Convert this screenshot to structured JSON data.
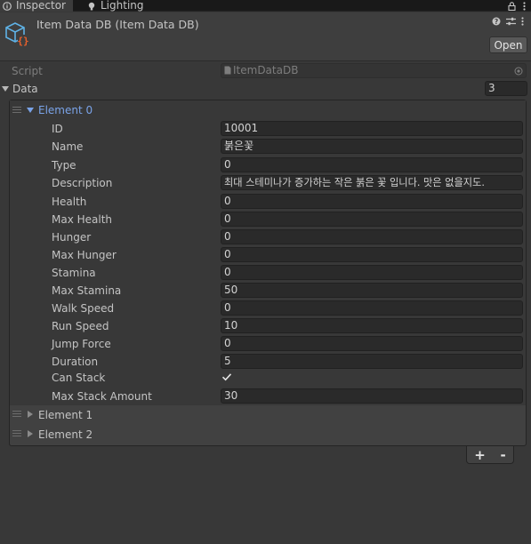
{
  "tabs": [
    {
      "label": "Inspector",
      "icon": "info-icon"
    },
    {
      "label": "Lighting",
      "icon": "bulb-icon"
    }
  ],
  "header": {
    "title": "Item Data DB (Item Data DB)",
    "open_label": "Open"
  },
  "script": {
    "label": "Script",
    "value": "ItemDataDB"
  },
  "data": {
    "label": "Data",
    "size": "3"
  },
  "element0": {
    "label": "Element 0",
    "props": [
      {
        "label": "ID",
        "value": "10001"
      },
      {
        "label": "Name",
        "value": "붉은꽃"
      },
      {
        "label": "Type",
        "value": "0"
      },
      {
        "label": "Description",
        "value": "최대 스테미나가 증가하는 작은 붉은 꽃 입니다. 맛은 없을지도."
      },
      {
        "label": "Health",
        "value": "0"
      },
      {
        "label": "Max Health",
        "value": "0"
      },
      {
        "label": "Hunger",
        "value": "0"
      },
      {
        "label": "Max Hunger",
        "value": "0"
      },
      {
        "label": "Stamina",
        "value": "0"
      },
      {
        "label": "Max Stamina",
        "value": "50"
      },
      {
        "label": "Walk Speed",
        "value": "0"
      },
      {
        "label": "Run Speed",
        "value": "10"
      },
      {
        "label": "Jump Force",
        "value": "0"
      },
      {
        "label": "Duration",
        "value": "5"
      }
    ],
    "can_stack": {
      "label": "Can Stack",
      "checked": true
    },
    "max_stack": {
      "label": "Max Stack Amount",
      "value": "30"
    }
  },
  "element1": {
    "label": "Element 1"
  },
  "element2": {
    "label": "Element 2"
  },
  "list_controls": {
    "add": "+",
    "remove": "-"
  },
  "colors": {
    "selected_element": "#7aa3e8",
    "background": "#383838"
  }
}
